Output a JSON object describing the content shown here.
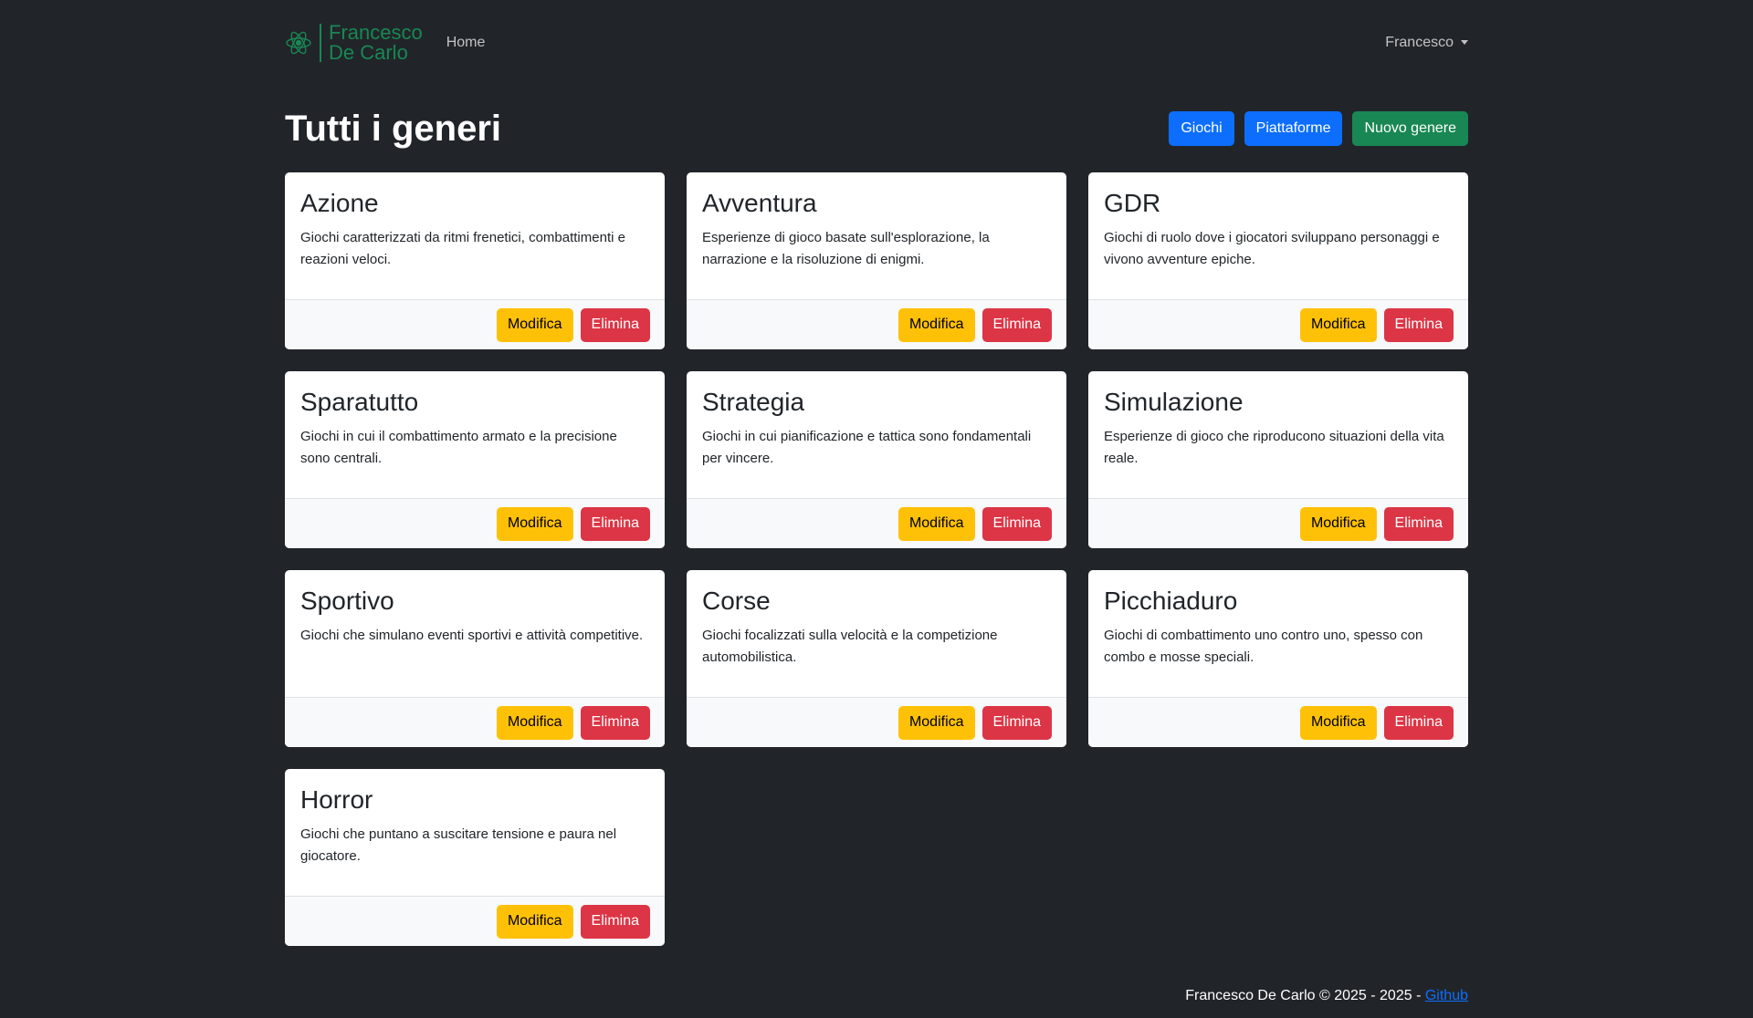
{
  "navbar": {
    "brand_line1": "Francesco",
    "brand_line2": "De Carlo",
    "brand_icon": "atom-icon",
    "home_label": "Home",
    "user_label": "Francesco"
  },
  "header": {
    "title": "Tutti i generi",
    "buttons": {
      "games": "Giochi",
      "platforms": "Piattaforme",
      "new_genre": "Nuovo genere"
    }
  },
  "genres": [
    {
      "name": "Azione",
      "description": "Giochi caratterizzati da ritmi frenetici, combattimenti e reazioni veloci.",
      "edit": "Modifica",
      "delete": "Elimina"
    },
    {
      "name": "Avventura",
      "description": "Esperienze di gioco basate sull'esplorazione, la narrazione e la risoluzione di enigmi.",
      "edit": "Modifica",
      "delete": "Elimina"
    },
    {
      "name": "GDR",
      "description": "Giochi di ruolo dove i giocatori sviluppano personaggi e vivono avventure epiche.",
      "edit": "Modifica",
      "delete": "Elimina"
    },
    {
      "name": "Sparatutto",
      "description": "Giochi in cui il combattimento armato e la precisione sono centrali.",
      "edit": "Modifica",
      "delete": "Elimina"
    },
    {
      "name": "Strategia",
      "description": "Giochi in cui pianificazione e tattica sono fondamentali per vincere.",
      "edit": "Modifica",
      "delete": "Elimina"
    },
    {
      "name": "Simulazione",
      "description": "Esperienze di gioco che riproducono situazioni della vita reale.",
      "edit": "Modifica",
      "delete": "Elimina"
    },
    {
      "name": "Sportivo",
      "description": "Giochi che simulano eventi sportivi e attività competitive.",
      "edit": "Modifica",
      "delete": "Elimina"
    },
    {
      "name": "Corse",
      "description": "Giochi focalizzati sulla velocità e la competizione automobilistica.",
      "edit": "Modifica",
      "delete": "Elimina"
    },
    {
      "name": "Picchiaduro",
      "description": "Giochi di combattimento uno contro uno, spesso con combo e mosse speciali.",
      "edit": "Modifica",
      "delete": "Elimina"
    },
    {
      "name": "Horror",
      "description": "Giochi che puntano a suscitare tensione e paura nel giocatore.",
      "edit": "Modifica",
      "delete": "Elimina"
    }
  ],
  "footer": {
    "text": "Francesco De Carlo © 2025 - 2025 -",
    "link": "Github"
  },
  "colors": {
    "background": "#212529",
    "brand": "#198754",
    "primary": "#0d6efd",
    "success": "#198754",
    "warning": "#ffc107",
    "danger": "#dc3545"
  }
}
